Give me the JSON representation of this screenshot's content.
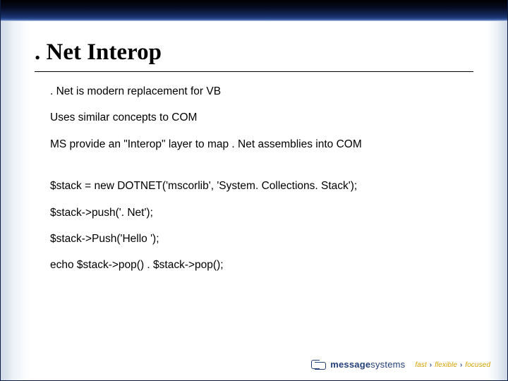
{
  "title": ". Net Interop",
  "bullets": [
    ". Net is modern replacement for VB",
    "Uses similar concepts to COM",
    "MS provide an \"Interop\" layer to map . Net assemblies into COM"
  ],
  "code": [
    "$stack = new DOTNET('mscorlib', 'System. Collections. Stack');",
    "$stack->push('. Net');",
    "$stack->Push('Hello ');",
    "echo $stack->pop() . $stack->pop();"
  ],
  "footer": {
    "logo_word1": "message",
    "logo_word2": "systems",
    "tag1": "fast",
    "tag2": "flexible",
    "tag3": "focused"
  }
}
